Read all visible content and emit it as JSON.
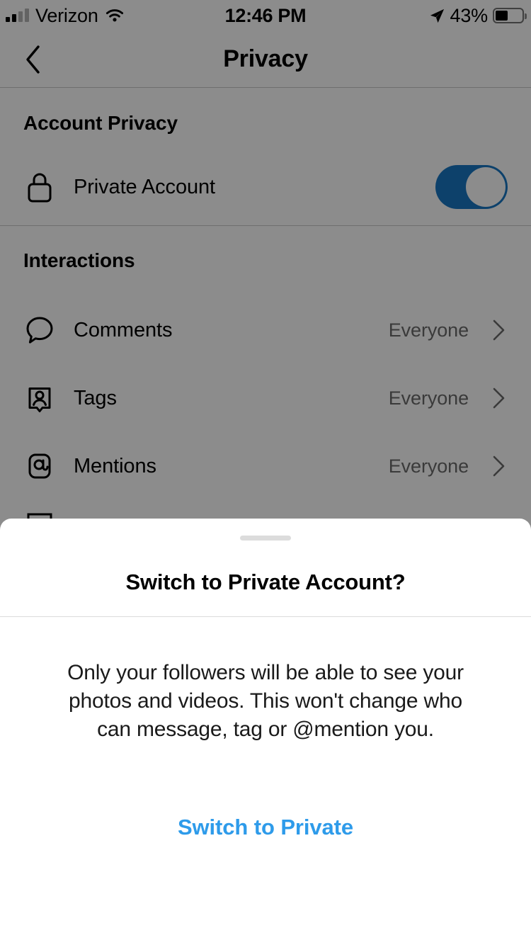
{
  "status_bar": {
    "carrier": "Verizon",
    "signal_icon": "signal-bars-icon",
    "wifi_icon": "wifi-icon",
    "time": "12:46 PM",
    "location_icon": "location-arrow-icon",
    "battery_percent": "43%",
    "battery_level": 43,
    "battery_icon": "battery-icon"
  },
  "nav": {
    "back_icon": "chevron-left-icon",
    "title": "Privacy"
  },
  "sections": [
    {
      "header": "Account Privacy",
      "rows": [
        {
          "icon": "lock-icon",
          "label": "Private Account",
          "control": "toggle",
          "toggle_on": true
        }
      ]
    },
    {
      "header": "Interactions",
      "rows": [
        {
          "icon": "comment-bubble-icon",
          "label": "Comments",
          "value": "Everyone",
          "chevron": "chevron-right-icon"
        },
        {
          "icon": "tag-person-icon",
          "label": "Tags",
          "value": "Everyone",
          "chevron": "chevron-right-icon"
        },
        {
          "icon": "at-mention-icon",
          "label": "Mentions",
          "value": "Everyone",
          "chevron": "chevron-right-icon"
        }
      ]
    }
  ],
  "sheet": {
    "handle": "drag-handle",
    "title": "Switch to Private Account?",
    "body": "Only your followers will be able to see your photos and videos. This won't change who can message, tag or @mention you.",
    "action_label": "Switch to Private"
  },
  "colors": {
    "accent_blue": "#2e9bea",
    "toggle_on": "#1977c3",
    "value_gray": "#6b6b6b",
    "divider": "#c8c8c8",
    "sheet_divider": "#dbdbdb",
    "handle": "#dcdcdc"
  }
}
